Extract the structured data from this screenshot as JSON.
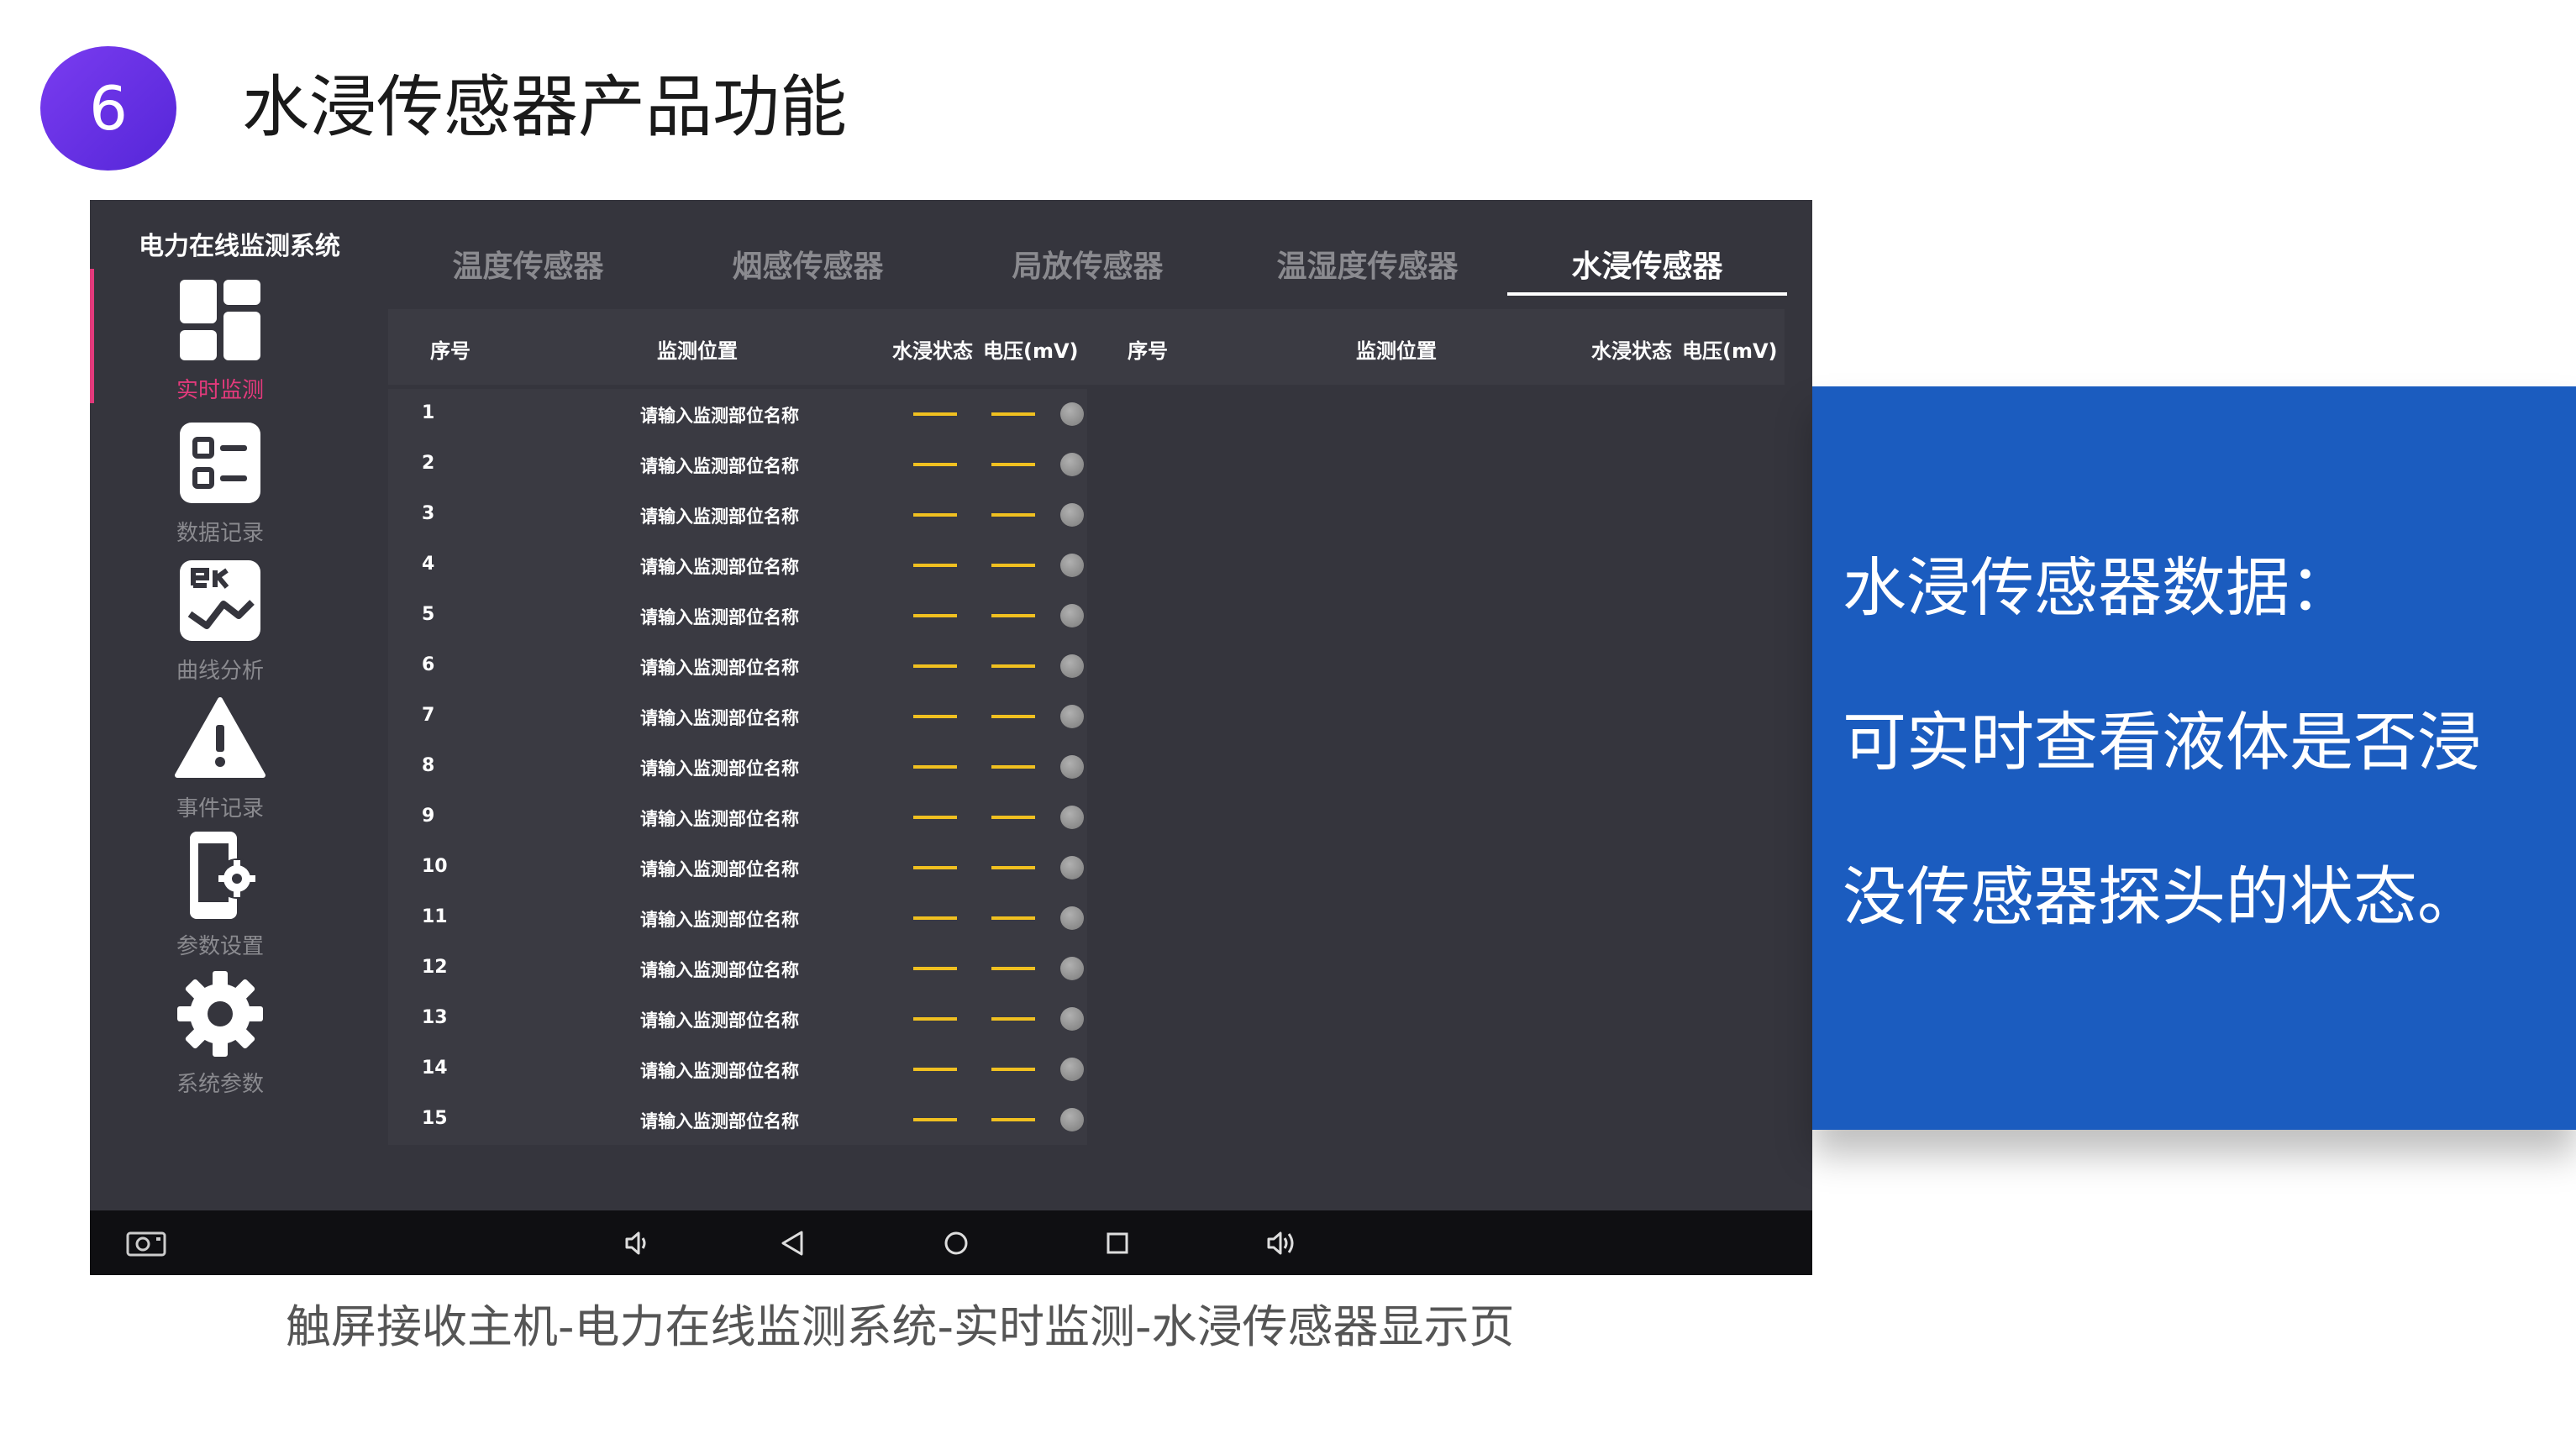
{
  "slide": {
    "number": "6",
    "title": "水浸传感器产品功能",
    "caption": "触屏接收主机-电力在线监测系统-实时监测-水浸传感器显示页",
    "card_lines": [
      "水浸传感器数据：",
      "可实时查看液体是否浸",
      "没传感器探头的状态。"
    ]
  },
  "app": {
    "title": "电力在线监测系统",
    "nav": [
      {
        "label": "实时监测",
        "icon": "dashboard-icon",
        "active": true
      },
      {
        "label": "数据记录",
        "icon": "list-icon",
        "active": false
      },
      {
        "label": "曲线分析",
        "icon": "chart-icon",
        "active": false
      },
      {
        "label": "事件记录",
        "icon": "warning-icon",
        "active": false
      },
      {
        "label": "参数设置",
        "icon": "device-settings-icon",
        "active": false
      },
      {
        "label": "系统参数",
        "icon": "gear-icon",
        "active": false
      }
    ],
    "tabs": [
      "温度传感器",
      "烟感传感器",
      "局放传感器",
      "温湿度传感器",
      "水浸传感器"
    ],
    "active_tab": "水浸传感器",
    "columns": {
      "left": [
        "序号",
        "监测位置",
        "水浸状态",
        "电压(mV)"
      ],
      "right": [
        "序号",
        "监测位置",
        "水浸状态",
        "电压(mV)"
      ]
    },
    "rows": [
      {
        "idx": "1",
        "location": "请输入监测部位名称",
        "state": "—",
        "voltage": "—"
      },
      {
        "idx": "2",
        "location": "请输入监测部位名称",
        "state": "—",
        "voltage": "—"
      },
      {
        "idx": "3",
        "location": "请输入监测部位名称",
        "state": "—",
        "voltage": "—"
      },
      {
        "idx": "4",
        "location": "请输入监测部位名称",
        "state": "—",
        "voltage": "—"
      },
      {
        "idx": "5",
        "location": "请输入监测部位名称",
        "state": "—",
        "voltage": "—"
      },
      {
        "idx": "6",
        "location": "请输入监测部位名称",
        "state": "—",
        "voltage": "—"
      },
      {
        "idx": "7",
        "location": "请输入监测部位名称",
        "state": "—",
        "voltage": "—"
      },
      {
        "idx": "8",
        "location": "请输入监测部位名称",
        "state": "—",
        "voltage": "—"
      },
      {
        "idx": "9",
        "location": "请输入监测部位名称",
        "state": "—",
        "voltage": "—"
      },
      {
        "idx": "10",
        "location": "请输入监测部位名称",
        "state": "—",
        "voltage": "—"
      },
      {
        "idx": "11",
        "location": "请输入监测部位名称",
        "state": "—",
        "voltage": "—"
      },
      {
        "idx": "12",
        "location": "请输入监测部位名称",
        "state": "—",
        "voltage": "—"
      },
      {
        "idx": "13",
        "location": "请输入监测部位名称",
        "state": "—",
        "voltage": "—"
      },
      {
        "idx": "14",
        "location": "请输入监测部位名称",
        "state": "—",
        "voltage": "—"
      },
      {
        "idx": "15",
        "location": "请输入监测部位名称",
        "state": "—",
        "voltage": "—"
      }
    ],
    "system_bar": [
      "screenshot-icon",
      "volume-down-icon",
      "back-icon",
      "home-icon",
      "recents-icon",
      "volume-up-icon"
    ]
  },
  "colors": {
    "accent": "#e33a7c",
    "badge": "#5f2ee0",
    "card": "#1b5cbf",
    "screen_bg": "#35353d",
    "dash": "#f0c020"
  }
}
